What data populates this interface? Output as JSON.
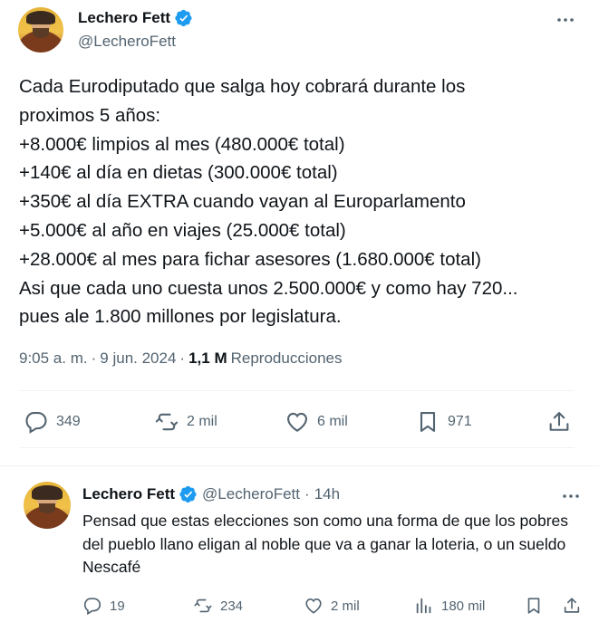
{
  "tweet": {
    "author_name": "Lechero Fett",
    "author_handle": "@LecheroFett",
    "text": "Cada Eurodiputado que salga hoy cobrará durante los\nproximos 5 años:\n+8.000€ limpios al mes (480.000€ total)\n+140€ al día en dietas (300.000€ total)\n+350€ al día EXTRA cuando vayan al Europarlamento\n+5.000€ al año en viajes (25.000€ total)\n+28.000€ al mes para fichar asesores (1.680.000€ total)\nAsi que cada uno cuesta unos 2.500.000€ y como hay 720...\npues ale 1.800 millones por legislatura.",
    "time": "9:05 a. m.",
    "separator": "·",
    "date": "9 jun. 2024",
    "views_count": "1,1 M",
    "views_label": "Reproducciones",
    "actions": {
      "replies": "349",
      "reposts": "2 mil",
      "likes": "6 mil",
      "bookmarks": "971"
    }
  },
  "reply": {
    "author_name": "Lechero Fett",
    "author_handle": "@LecheroFett",
    "separator": "·",
    "time_ago": "14h",
    "text": "Pensad que estas elecciones son como una forma de que los pobres del pueblo llano eligan al noble que va a ganar la loteria, o un sueldo Nescafé",
    "actions": {
      "replies": "19",
      "reposts": "234",
      "likes": "2 mil",
      "views": "180 mil"
    }
  },
  "colors": {
    "text": "#0f1419",
    "secondary": "#536471",
    "verified": "#1d9bf0",
    "divider": "#eff3f4"
  },
  "icons": [
    "more-icon",
    "verified-badge-icon",
    "reply-icon",
    "repost-icon",
    "like-icon",
    "bookmark-icon",
    "share-icon",
    "views-icon"
  ]
}
